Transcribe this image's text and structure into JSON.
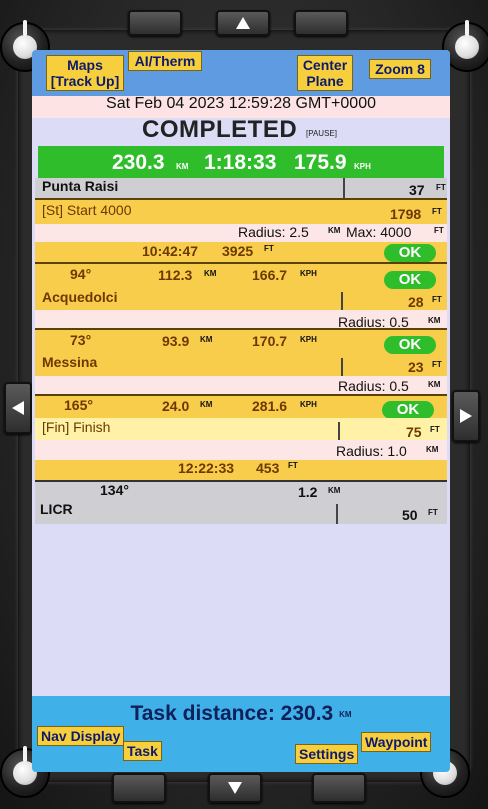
{
  "softkeys": {
    "maps": "Maps\n[Track Up]",
    "ai_therm": "AI/Therm",
    "center_plane": "Center\nPlane",
    "zoom": "Zoom 8",
    "nav_display": "Nav Display",
    "task": "Task",
    "settings": "Settings",
    "waypoint": "Waypoint"
  },
  "header": {
    "datetime": "Sat Feb 04 2023 12:59:28 GMT+0000",
    "status": "COMPLETED",
    "pause": "[PAUSE]"
  },
  "summary": {
    "distance": "230.3",
    "distance_unit": "KM",
    "time": "1:18:33",
    "speed": "175.9",
    "speed_unit": "KPH"
  },
  "waypoints": {
    "departure": {
      "name": "Punta Raisi",
      "elev": "37",
      "elev_unit": "FT"
    },
    "start": {
      "name": "[St] Start 4000",
      "elev": "1798",
      "elev_unit": "FT",
      "radius_label": "Radius: 2.5",
      "radius_unit": "KM",
      "max_label": "Max: 4000",
      "max_unit": "FT",
      "time": "10:42:47",
      "alt": "3925",
      "alt_unit": "FT",
      "ok": "OK"
    },
    "leg1": {
      "bearing": "94°",
      "dist": "112.3",
      "dist_unit": "KM",
      "speed": "166.7",
      "speed_unit": "KPH",
      "ok": "OK",
      "name": "Acquedolci",
      "elev": "28",
      "elev_unit": "FT",
      "radius_label": "Radius: 0.5",
      "radius_unit": "KM"
    },
    "leg2": {
      "bearing": "73°",
      "dist": "93.9",
      "dist_unit": "KM",
      "speed": "170.7",
      "speed_unit": "KPH",
      "ok": "OK",
      "name": "Messina",
      "elev": "23",
      "elev_unit": "FT",
      "radius_label": "Radius: 0.5",
      "radius_unit": "KM"
    },
    "leg3": {
      "bearing": "165°",
      "dist": "24.0",
      "dist_unit": "KM",
      "speed": "281.6",
      "speed_unit": "KPH",
      "ok": "OK",
      "name": "[Fin] Finish",
      "elev": "75",
      "elev_unit": "FT",
      "radius_label": "Radius: 1.0",
      "radius_unit": "KM",
      "time": "12:22:33",
      "alt": "453",
      "alt_unit": "FT"
    },
    "arrival": {
      "bearing": "134°",
      "dist": "1.2",
      "dist_unit": "KM",
      "name": "LICR",
      "elev": "50",
      "elev_unit": "FT"
    }
  },
  "footer": {
    "task_distance": "Task distance: 230.3",
    "task_distance_unit": "KM"
  },
  "hardware": {
    "up_icon": "triangle-up-icon",
    "down_icon": "triangle-down-icon",
    "left_icon": "triangle-left-icon",
    "right_icon": "triangle-right-icon",
    "knob_icon": "rotary-knob-icon"
  }
}
